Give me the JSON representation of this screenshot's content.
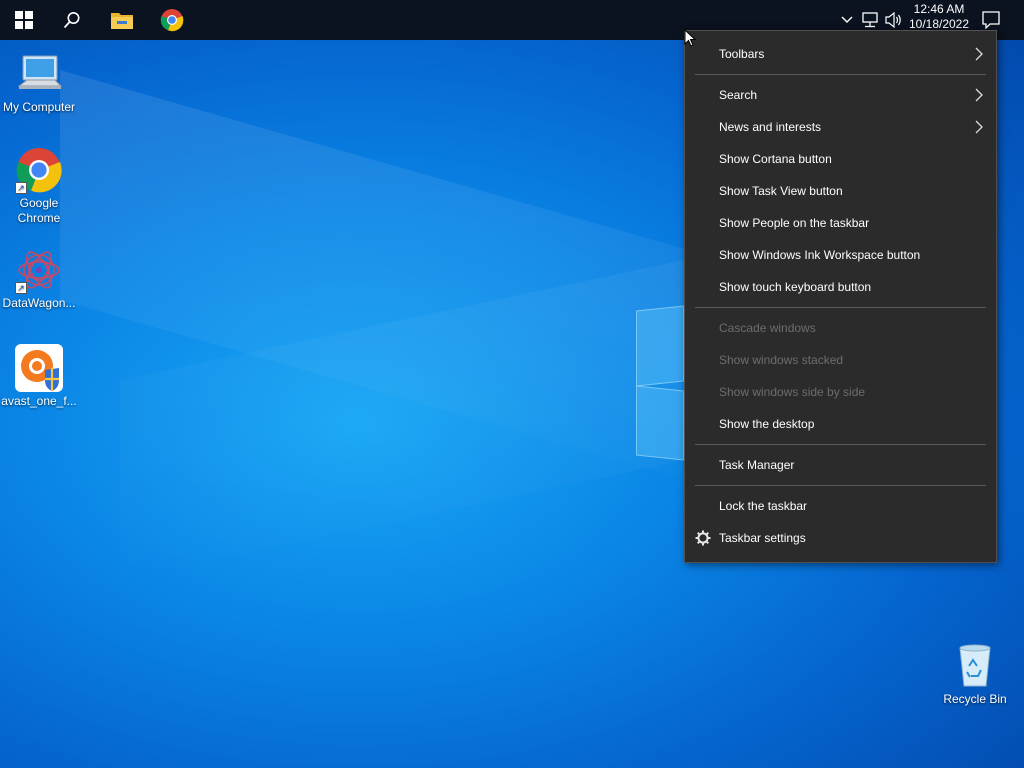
{
  "taskbar": {
    "buttons": [
      {
        "name": "start-icon"
      },
      {
        "name": "search-icon"
      },
      {
        "name": "file-explorer-icon"
      },
      {
        "name": "chrome-icon"
      }
    ],
    "tray": {
      "chevron": "chevron-up-icon",
      "network": "network-icon",
      "volume": "volume-icon",
      "notifications": "notification-icon"
    },
    "clock": {
      "time": "12:46 AM",
      "date": "10/18/2022"
    }
  },
  "desktop": {
    "icons": [
      {
        "label": "My Computer",
        "icon": "computer-icon"
      },
      {
        "label": "Google Chrome",
        "icon": "chrome-icon"
      },
      {
        "label": "DataWagon...",
        "icon": "datawagon-icon"
      },
      {
        "label": "avast_one_f...",
        "icon": "avast-icon"
      },
      {
        "label": "Recycle Bin",
        "icon": "recycle-bin-icon"
      }
    ]
  },
  "context_menu": {
    "items": [
      {
        "label": "Toolbars",
        "submenu": true
      },
      {
        "label": "Search",
        "submenu": true
      },
      {
        "label": "News and interests",
        "submenu": true
      },
      {
        "label": "Show Cortana button"
      },
      {
        "label": "Show Task View button"
      },
      {
        "label": "Show People on the taskbar"
      },
      {
        "label": "Show Windows Ink Workspace button"
      },
      {
        "label": "Show touch keyboard button"
      },
      {
        "label": "Cascade windows",
        "disabled": true
      },
      {
        "label": "Show windows stacked",
        "disabled": true
      },
      {
        "label": "Show windows side by side",
        "disabled": true
      },
      {
        "label": "Show the desktop"
      },
      {
        "label": "Task Manager"
      },
      {
        "label": "Lock the taskbar"
      },
      {
        "label": "Taskbar settings",
        "icon": "gear-icon"
      }
    ]
  },
  "colors": {
    "taskbar_bg": "#0b1220",
    "menu_bg": "#2b2b2b",
    "menu_disabled_text": "#6d6d6d",
    "desktop_blue": "#0a86e6"
  }
}
